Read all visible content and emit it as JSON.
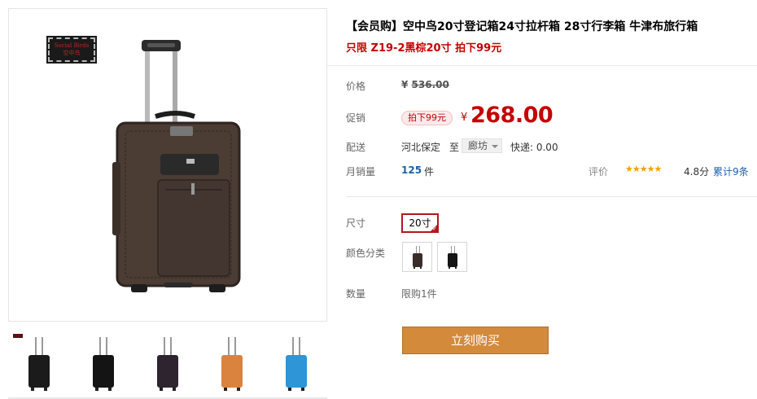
{
  "gallery": {
    "logo_line1": "Social Birds",
    "logo_line2": "空中鸟",
    "thumb_colors": [
      "#1b1b1b",
      "#141414",
      "#2e2430",
      "#d9833f",
      "#2e95d6"
    ]
  },
  "product": {
    "title": "【会员购】空中鸟20寸登记箱24寸拉杆箱 28寸行李箱 牛津布旅行箱",
    "subtitle": "只限 Z19-2黑棕20寸 拍下99元"
  },
  "price": {
    "label": "价格",
    "currency": "¥",
    "original": "536.00"
  },
  "promo": {
    "label": "促销",
    "tag": "拍下99元",
    "currency": "¥",
    "price": "268.00"
  },
  "delivery": {
    "label": "配送",
    "from": "河北保定",
    "to_word": "至",
    "city": "廊坊",
    "express": "快递: 0.00"
  },
  "sales": {
    "label": "月销量",
    "count": "125",
    "unit": "件",
    "review_label": "评价",
    "stars": "★★★★★",
    "score": "4.8分",
    "review_count": "累计9条"
  },
  "options": {
    "size_label": "尺寸",
    "size_value": "20寸",
    "color_label": "颜色分类",
    "quantity_label": "数量",
    "quantity_note": "限购1件"
  },
  "buy_button": "立刻购买",
  "colors": {
    "accent_red": "#c40000",
    "buy_orange": "#d38a3b",
    "link_blue": "#1c5fa8",
    "star": "#f5a100"
  }
}
